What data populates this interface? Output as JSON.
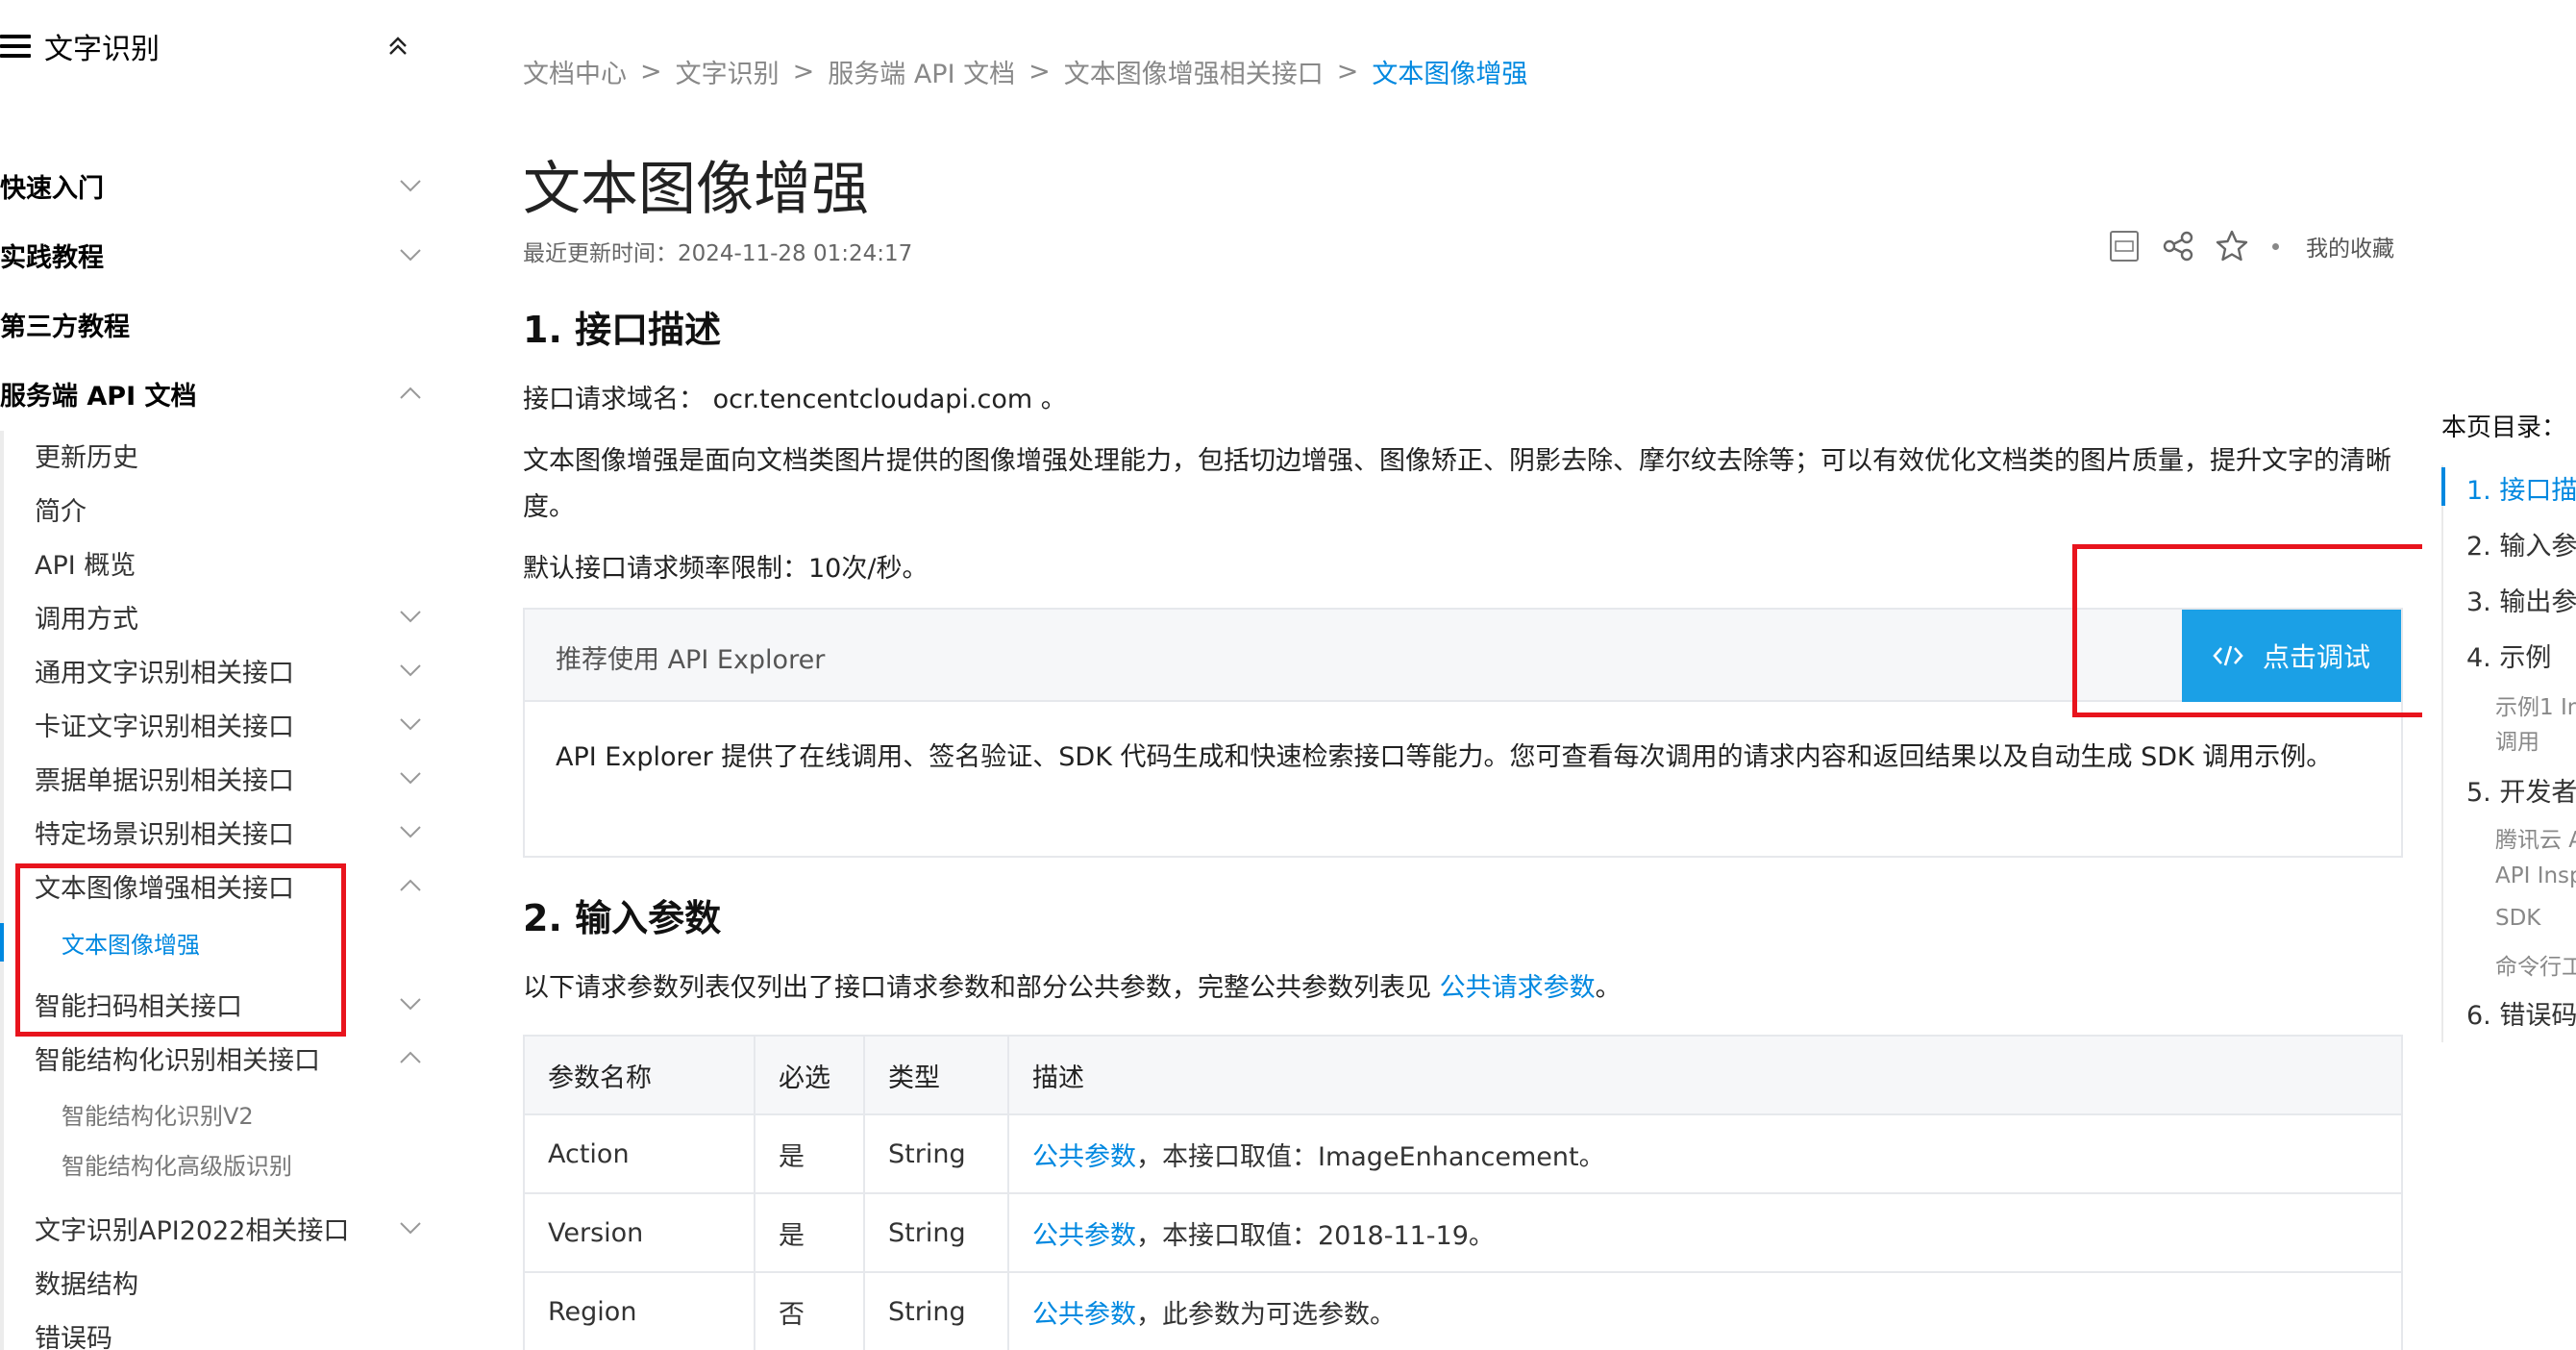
{
  "sidebar": {
    "title": "文字识别",
    "sections": [
      {
        "label": "快速入门"
      },
      {
        "label": "实践教程"
      },
      {
        "label": "第三方教程"
      },
      {
        "label": "服务端 API 文档"
      }
    ],
    "items": [
      {
        "label": "更新历史"
      },
      {
        "label": "简介"
      },
      {
        "label": "API 概览"
      },
      {
        "label": "调用方式"
      },
      {
        "label": "通用文字识别相关接口"
      },
      {
        "label": "卡证文字识别相关接口"
      },
      {
        "label": "票据单据识别相关接口"
      },
      {
        "label": "特定场景识别相关接口"
      },
      {
        "label": "文本图像增强相关接口"
      },
      {
        "label": "智能扫码相关接口"
      },
      {
        "label": "智能结构化识别相关接口"
      },
      {
        "label": "文字识别API2022相关接口"
      },
      {
        "label": "数据结构"
      },
      {
        "label": "错误码"
      }
    ],
    "subitems": [
      {
        "label": "文本图像增强"
      },
      {
        "label": "智能结构化识别V2"
      },
      {
        "label": "智能结构化高级版识别"
      }
    ]
  },
  "breadcrumb": [
    "文档中心",
    "文字识别",
    "服务端 API 文档",
    "文本图像增强相关接口",
    "文本图像增强"
  ],
  "breadcrumb_sep": ">",
  "page": {
    "title": "文本图像增强",
    "updated": "最近更新时间：2024-11-28 01:24:17",
    "favorite": "我的收藏"
  },
  "section1": {
    "heading": "1. 接口描述",
    "domain_label": "接口请求域名：",
    "domain_value": "ocr.tencentcloudapi.com",
    "domain_suffix": "。",
    "desc": "文本图像增强是面向文档类图片提供的图像增强处理能力，包括切边增强、图像矫正、阴影去除、摩尔纹去除等；可以有效优化文档类的图片质量，提升文字的清晰度。",
    "rate": "默认接口请求频率限制：10次/秒。"
  },
  "explorer": {
    "title": "推荐使用 API Explorer",
    "button": "点击调试",
    "body": "API Explorer 提供了在线调用、签名验证、SDK 代码生成和快速检索接口等能力。您可查看每次调用的请求内容和返回结果以及自动生成 SDK 调用示例。"
  },
  "section2": {
    "heading": "2. 输入参数",
    "intro": "以下请求参数列表仅列出了接口请求参数和部分公共参数，完整公共参数列表见 ",
    "intro_link": "公共请求参数",
    "intro_end": "。"
  },
  "params": {
    "headers": [
      "参数名称",
      "必选",
      "类型",
      "描述"
    ],
    "rows": [
      {
        "name": "Action",
        "required": "是",
        "type": "String",
        "link": "公共参数",
        "desc": "，本接口取值：ImageEnhancement。"
      },
      {
        "name": "Version",
        "required": "是",
        "type": "String",
        "link": "公共参数",
        "desc": "，本接口取值：2018-11-19。"
      },
      {
        "name": "Region",
        "required": "否",
        "type": "String",
        "link": "公共参数",
        "desc": "，此参数为可选参数。"
      }
    ]
  },
  "toc": {
    "title": "本页目录：",
    "items": [
      {
        "label": "1. 接口描"
      },
      {
        "label": "2. 输入参"
      },
      {
        "label": "3. 输出参"
      },
      {
        "label": "4. 示例"
      },
      {
        "label": "5. 开发者"
      },
      {
        "label": "6. 错误码"
      }
    ],
    "subitems": [
      {
        "label": "示例1 In"
      },
      {
        "label": "调用"
      },
      {
        "label": "腾讯云 A"
      },
      {
        "label": "API Insp"
      },
      {
        "label": "SDK"
      },
      {
        "label": "命令行工"
      }
    ]
  },
  "colors": {
    "accent": "#0088e0",
    "button": "#1ba0e6",
    "highlight_box": "#e8141d"
  }
}
